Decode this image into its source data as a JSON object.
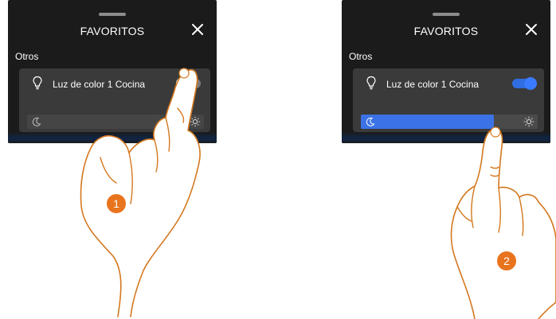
{
  "panels": [
    {
      "header": {
        "title": "FAVORITOS",
        "close_icon": "close-icon"
      },
      "section_label": "Otros",
      "device": {
        "label": "Luz de color 1 Cocina",
        "icon": "lightbulb-icon",
        "toggle_state": "off",
        "brightness_percent": 0
      },
      "step_badge": "1"
    },
    {
      "header": {
        "title": "FAVORITOS",
        "close_icon": "close-icon"
      },
      "section_label": "Otros",
      "device": {
        "label": "Luz de color 1 Cocina",
        "icon": "lightbulb-icon",
        "toggle_state": "on",
        "brightness_percent": 75
      },
      "step_badge": "2"
    }
  ],
  "colors": {
    "screen_bg": "#1b1b1b",
    "card_bg": "#3a3a3a",
    "accent_blue": "#3b72e6",
    "badge_orange": "#e8741e",
    "hand_outline": "#d4781f"
  }
}
